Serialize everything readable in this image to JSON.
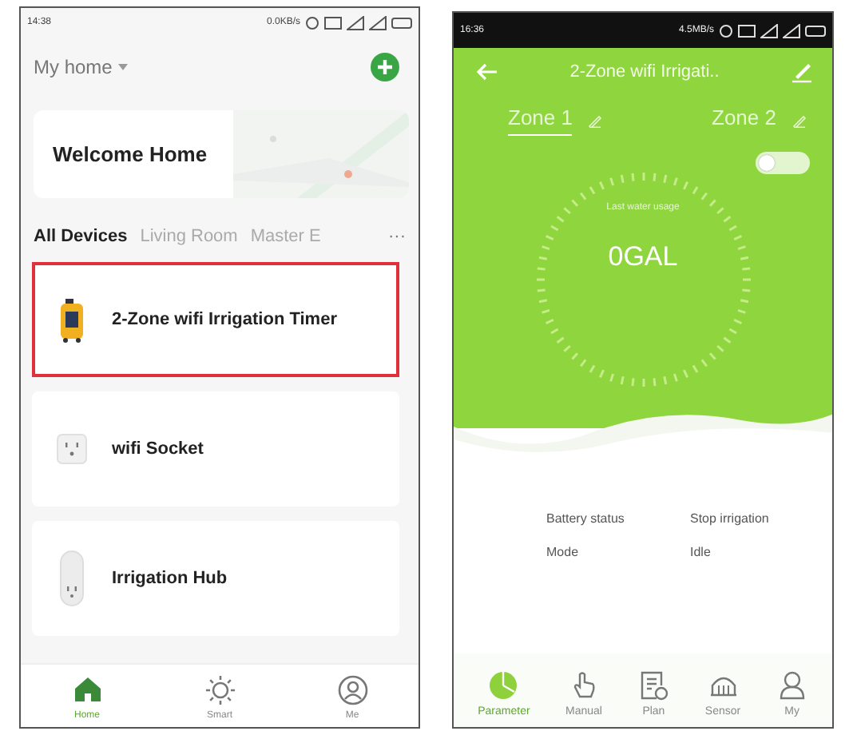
{
  "home_screen": {
    "status_bar": {
      "time": "14:38",
      "speed": "0.0KB/s"
    },
    "home_selector": "My home",
    "welcome": "Welcome Home",
    "room_tabs": [
      {
        "label": "All Devices",
        "selected": true
      },
      {
        "label": "Living Room",
        "selected": false
      },
      {
        "label": "Master E",
        "selected": false
      }
    ],
    "more": "···",
    "devices": [
      {
        "name": "2-Zone wifi Irrigation Timer",
        "kind": "timer",
        "highlighted": true
      },
      {
        "name": "wifi Socket",
        "kind": "socket",
        "highlighted": false
      },
      {
        "name": "Irrigation Hub",
        "kind": "hub",
        "highlighted": false
      }
    ],
    "nav": [
      {
        "label": "Home",
        "kind": "home",
        "selected": true
      },
      {
        "label": "Smart",
        "kind": "smart",
        "selected": false
      },
      {
        "label": "Me",
        "kind": "me",
        "selected": false
      }
    ]
  },
  "device_screen": {
    "status_bar": {
      "time": "16:36",
      "speed": "4.5MB/s"
    },
    "title": "2-Zone wifi Irrigati..",
    "zones": [
      {
        "label": "Zone 1",
        "selected": true
      },
      {
        "label": "Zone 2",
        "selected": false
      }
    ],
    "toggle": {
      "on": false
    },
    "usage_label": "Last water usage",
    "usage_value": "0GAL",
    "params": [
      {
        "label": "Battery status",
        "value": "Stop irrigation"
      },
      {
        "label": "Mode",
        "value": "Idle"
      }
    ],
    "nav": [
      {
        "label": "Parameter",
        "kind": "parameter",
        "selected": true
      },
      {
        "label": "Manual",
        "kind": "manual",
        "selected": false
      },
      {
        "label": "Plan",
        "kind": "plan",
        "selected": false
      },
      {
        "label": "Sensor",
        "kind": "sensor",
        "selected": false
      },
      {
        "label": "My",
        "kind": "my",
        "selected": false
      }
    ]
  }
}
